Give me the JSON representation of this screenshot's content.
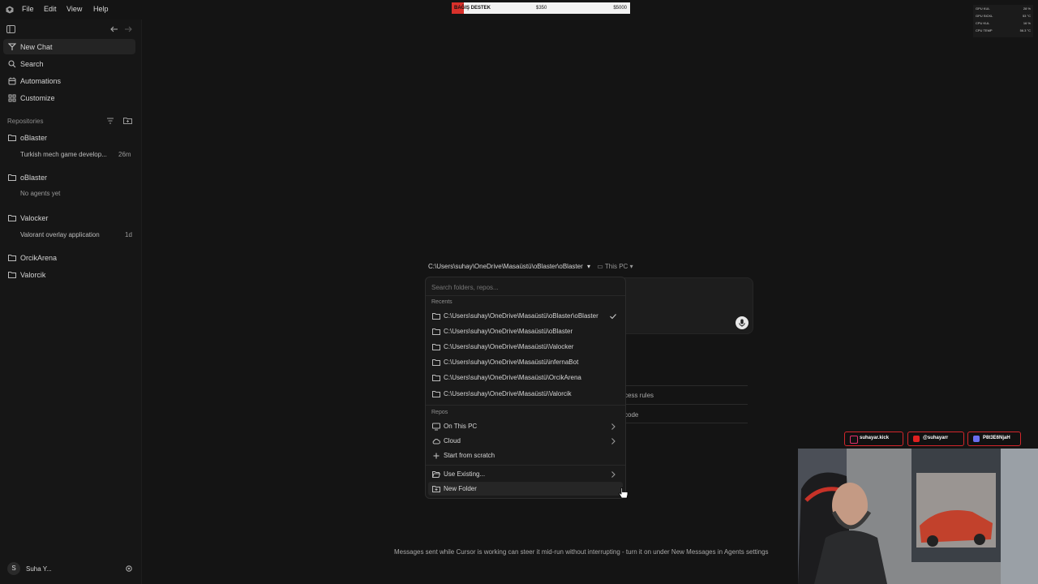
{
  "app": {
    "logo_icon": "cursor-logo-icon"
  },
  "menubar": {
    "file": "File",
    "edit": "Edit",
    "view": "View",
    "help": "Help"
  },
  "donation": {
    "label": "BAĞIŞ DESTEK",
    "current": "$350",
    "goal": "$5000",
    "progress": 0.07,
    "color": "#d9312b"
  },
  "stats": [
    {
      "label": "GPU KUL",
      "value": "28 %"
    },
    {
      "label": "GPU SICKL",
      "value": "53 °C"
    },
    {
      "label": "CPU KUL",
      "value": "16 %"
    },
    {
      "label": "CPU TEMP",
      "value": "56.3 °C"
    }
  ],
  "sidebar": {
    "nav": [
      {
        "label": "New Chat",
        "icon": "new-chat-icon"
      },
      {
        "label": "Search",
        "icon": "search-icon"
      },
      {
        "label": "Automations",
        "icon": "automations-icon"
      },
      {
        "label": "Customize",
        "icon": "customize-icon"
      }
    ],
    "repositories_label": "Repositories",
    "repos": [
      {
        "name": "oBlaster",
        "sub": "Turkish mech game develop...",
        "time": "26m"
      },
      {
        "name": "oBlaster",
        "sub": "No agents yet",
        "time": ""
      },
      {
        "name": "Valocker",
        "sub": "Valorant overlay application",
        "time": "1d"
      },
      {
        "name": "OrcikArena",
        "sub": "",
        "time": ""
      },
      {
        "name": "Valorcik",
        "sub": "",
        "time": ""
      }
    ],
    "user": {
      "initial": "S",
      "name": "Suha Y..."
    }
  },
  "main": {
    "current_path": "C:\\Users\\suhay\\OneDrive\\Masaüstü\\oBlaster\\oBlaster",
    "location": "This PC",
    "peek": [
      "k",
      "cess rules",
      "code"
    ],
    "hint": "Messages sent while Cursor is working can steer it mid-run without interrupting - turn it on under New Messages in Agents settings"
  },
  "dropdown": {
    "search_placeholder": "Search folders, repos...",
    "recents_label": "Recents",
    "recents": [
      "C:\\Users\\suhay\\OneDrive\\Masaüstü\\oBlaster\\oBlaster",
      "C:\\Users\\suhay\\OneDrive\\Masaüstü\\oBlaster",
      "C:\\Users\\suhay\\OneDrive\\Masaüstü\\Valocker",
      "C:\\Users\\suhay\\OneDrive\\Masaüstü\\infernaBot",
      "C:\\Users\\suhay\\OneDrive\\Masaüstü\\OrcikArena",
      "C:\\Users\\suhay\\OneDrive\\Masaüstü\\Valorcik"
    ],
    "repos_label": "Repos",
    "repos": [
      {
        "label": "On This PC",
        "icon": "monitor-icon"
      },
      {
        "label": "Cloud",
        "icon": "cloud-icon"
      },
      {
        "label": "Start from scratch",
        "icon": "plus-icon"
      }
    ],
    "extra": [
      {
        "label": "Use Existing...",
        "icon": "folder-open-icon"
      },
      {
        "label": "New Folder",
        "icon": "new-folder-icon"
      }
    ]
  },
  "socials": [
    {
      "label": "suhayar.kick",
      "icon": "instagram-icon"
    },
    {
      "label": "@suhayarr",
      "icon": "youtube-icon"
    },
    {
      "label": "P8t3E6NjaH",
      "icon": "discord-icon"
    }
  ]
}
